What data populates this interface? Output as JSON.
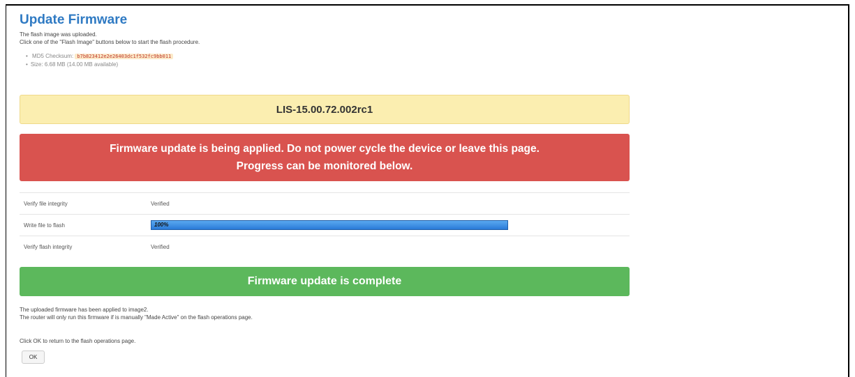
{
  "page": {
    "title": "Update Firmware",
    "intro_line1": "The flash image was uploaded.",
    "intro_line2": "Click one of the \"Flash Image\" buttons below to start the flash procedure."
  },
  "meta": {
    "md5_label": "MD5 Checksum:",
    "md5_value": "b7b823412e2e26403dc1f532fc9bb011",
    "size_text": "Size: 6.68 MB (14.00 MB available)"
  },
  "version": "LIS-15.00.72.002rc1",
  "warning": {
    "line1": "Firmware update is being applied. Do not power cycle the device or leave this page.",
    "line2": "Progress can be monitored below."
  },
  "steps": [
    {
      "label": "Verify file integrity",
      "status": "Verified"
    },
    {
      "label": "Write file to flash",
      "progress_text": "100%",
      "progress": 1.0
    },
    {
      "label": "Verify flash integrity",
      "status": "Verified"
    }
  ],
  "complete_text": "Firmware update is complete",
  "post": {
    "line1": "The uploaded firmware has been applied to image2.",
    "line2": "The router will only run this firmware if is manually \"Made Active\" on the flash operations page.",
    "line3": "Click OK to return to the flash operations page."
  },
  "ok_label": "OK",
  "colors": {
    "title": "#2f7ac3",
    "version_bg": "#fbeeb0",
    "warning_bg": "#d9534f",
    "success_bg": "#5cb85c",
    "progress_fill": "#2a7ad8"
  }
}
